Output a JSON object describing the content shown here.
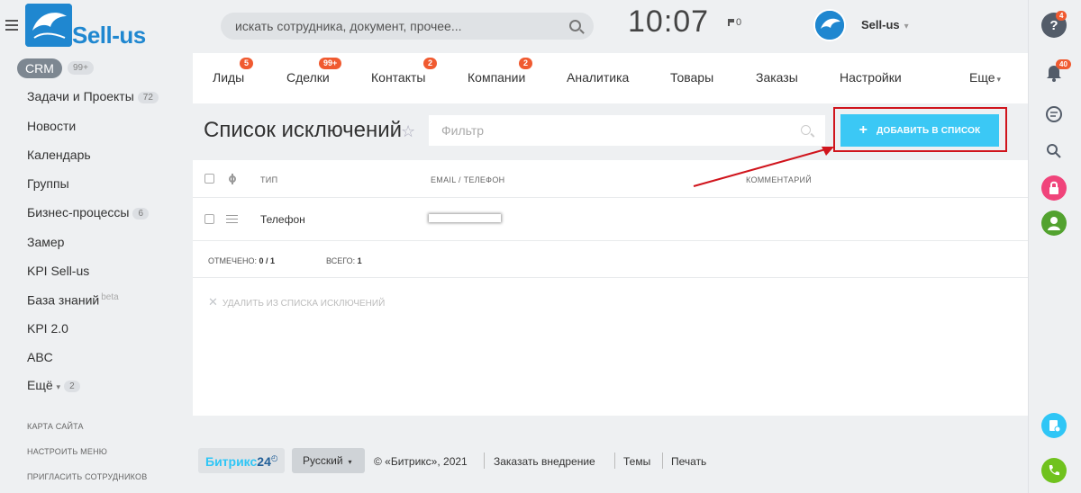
{
  "header": {
    "logo_text": "Sell-us",
    "search_placeholder": "искать сотрудника, документ, прочее...",
    "clock": "10:07",
    "flag_count": "0",
    "user_name": "Sell-us"
  },
  "sidebar": {
    "crm_label": "CRM",
    "crm_count": "99+",
    "items": [
      {
        "label": "Задачи и Проекты",
        "count": "72"
      },
      {
        "label": "Новости"
      },
      {
        "label": "Календарь"
      },
      {
        "label": "Группы"
      },
      {
        "label": "Бизнес-процессы",
        "count": "6"
      },
      {
        "label": "Замер"
      },
      {
        "label": "KPI Sell-us"
      },
      {
        "label": "База знаний",
        "sup": "beta"
      },
      {
        "label": "KPI 2.0"
      },
      {
        "label": "ABC"
      },
      {
        "label": "Ещё",
        "count": "2"
      }
    ],
    "links": [
      "КАРТА САЙТА",
      "НАСТРОИТЬ МЕНЮ",
      "ПРИГЛАСИТЬ СОТРУДНИКОВ"
    ]
  },
  "nav": [
    {
      "label": "Лиды",
      "badge": "5"
    },
    {
      "label": "Сделки",
      "badge": "99+"
    },
    {
      "label": "Контакты",
      "badge": "2"
    },
    {
      "label": "Компании",
      "badge": "2"
    },
    {
      "label": "Аналитика"
    },
    {
      "label": "Товары"
    },
    {
      "label": "Заказы"
    },
    {
      "label": "Настройки"
    },
    {
      "label": "Еще"
    }
  ],
  "page": {
    "title": "Список исключений",
    "filter_placeholder": "Фильтр",
    "add_button": "ДОБАВИТЬ В СПИСОК"
  },
  "table": {
    "columns": [
      "ТИП",
      "EMAIL / ТЕЛЕФОН",
      "КОММЕНТАРИЙ"
    ],
    "rows": [
      {
        "type": "Телефон",
        "contact": "",
        "comment": ""
      }
    ],
    "marked_label": "ОТМЕЧЕНО:",
    "marked_value": "0 / 1",
    "total_label": "ВСЕГО:",
    "total_value": "1",
    "delete_action": "УДАЛИТЬ ИЗ СПИСКА ИСКЛЮЧЕНИЙ"
  },
  "footer": {
    "brand_a": "Битрикс",
    "brand_b": "24",
    "language": "Русский",
    "copyright": "© «Битрикс», 2021",
    "order": "Заказать внедрение",
    "themes": "Темы",
    "print": "Печать"
  },
  "rail": {
    "help_badge": "4",
    "notif_badge": "40"
  },
  "colors": {
    "accent": "#3bc8f5",
    "badge": "#f05a30",
    "highlight": "#d0141c",
    "brand": "#1f87d0"
  }
}
